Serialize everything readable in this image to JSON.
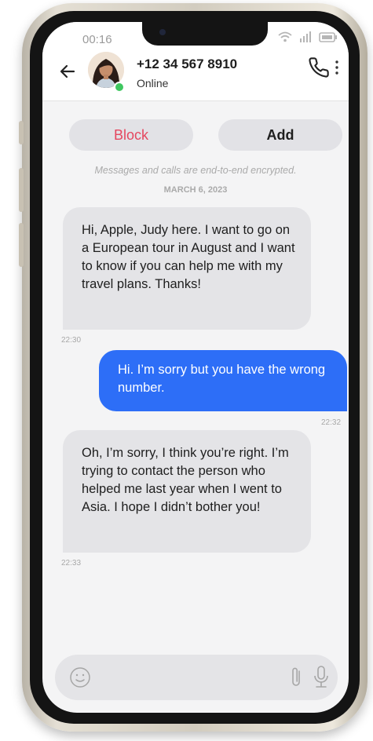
{
  "status_bar": {
    "time": "00:16"
  },
  "header": {
    "contact_name": "+12 34 567 8910",
    "contact_status": "Online"
  },
  "actions": {
    "block_label": "Block",
    "add_label": "Add"
  },
  "encryption_notice": "Messages and calls are end-to-end encrypted.",
  "date_label": "MARCH 6, 2023",
  "messages": [
    {
      "direction": "incoming",
      "text": "Hi, Apple, Judy here. I want to go on a European tour in August and I want to know if you can help me with my travel plans. Thanks!",
      "time": "22:30"
    },
    {
      "direction": "outgoing",
      "text": "Hi. I’m sorry but you have the wrong number.",
      "time": "22:32"
    },
    {
      "direction": "incoming",
      "text": "Oh, I’m sorry, I think you’re right. I’m trying to contact the person who helped me last year when I went to Asia. I hope I didn’t bother you!",
      "time": "22:33"
    }
  ],
  "colors": {
    "accent_blue": "#2d6ef7",
    "block_red": "#e5475f",
    "online_green": "#3fc760",
    "bubble_gray": "#e4e4e7"
  },
  "icons": {
    "back": "arrow-left-icon",
    "call": "phone-icon",
    "more": "vertical-dots-icon",
    "emoji": "smiley-icon",
    "attach": "paperclip-icon",
    "voice": "microphone-icon"
  }
}
